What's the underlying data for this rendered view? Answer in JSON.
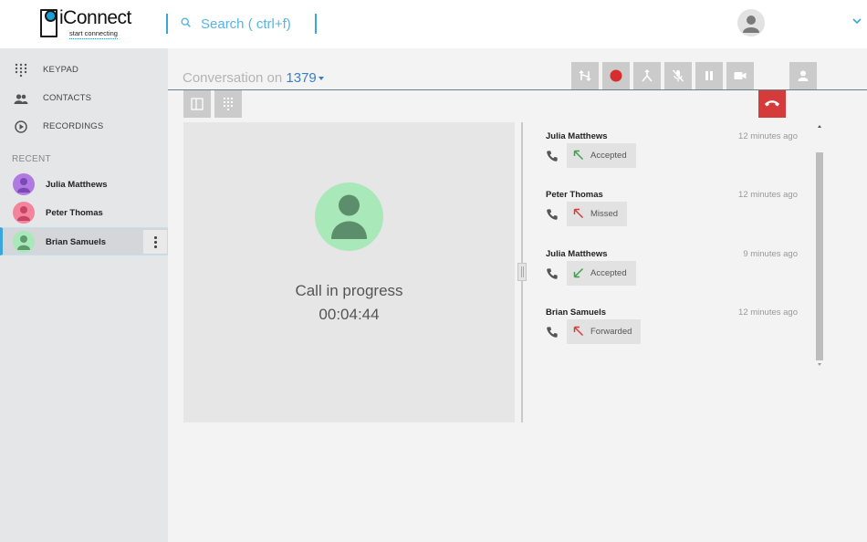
{
  "app": {
    "logo_name": "iConnect",
    "logo_tagline": "start connecting",
    "brand_color": "#1aa0d8"
  },
  "search": {
    "placeholder": "Search ( ctrl+f)",
    "icon": "search-icon"
  },
  "header": {
    "user_avatar_icon": "user-avatar-icon",
    "menu_icon": "chevron-down-icon"
  },
  "sidebar": {
    "nav": [
      {
        "label": "KEYPAD",
        "icon": "keypad-icon"
      },
      {
        "label": "CONTACTS",
        "icon": "contacts-icon"
      },
      {
        "label": "RECORDINGS",
        "icon": "play-circle-icon"
      }
    ],
    "recent_header": "RECENT",
    "recent": [
      {
        "name": "Julia Matthews",
        "avatar_color": "#b07be0",
        "figure_color": "#7b48b5"
      },
      {
        "name": "Peter Thomas",
        "avatar_color": "#f2849c",
        "figure_color": "#c84466"
      },
      {
        "name": "Brian Samuels",
        "avatar_color": "#a8e8b9",
        "figure_color": "#5d9a6f",
        "active": true
      }
    ]
  },
  "conversation": {
    "title_prefix": "Conversation on",
    "number": "1379",
    "toolbar": [
      {
        "icon": "transfer-icon"
      },
      {
        "icon": "record-icon"
      },
      {
        "icon": "merge-icon"
      },
      {
        "icon": "mute-mic-icon"
      },
      {
        "icon": "pause-icon"
      },
      {
        "icon": "video-icon"
      },
      {
        "icon": "contact-icon"
      }
    ],
    "secondary_toolbar": [
      {
        "icon": "split-panel-icon"
      },
      {
        "icon": "dialpad-icon"
      }
    ],
    "hangup_icon": "hangup-icon",
    "hangup_color": "#d63b3b"
  },
  "call": {
    "status": "Call in progress",
    "timer": "00:04:44",
    "avatar_color": "#a8e8b9"
  },
  "history": [
    {
      "name": "Julia Matthews",
      "time": "12 minutes ago",
      "status": "Accepted",
      "arrow_color": "#3aa04a"
    },
    {
      "name": "Peter Thomas",
      "time": "12 minutes ago",
      "status": "Missed",
      "arrow_color": "#d63b3b"
    },
    {
      "name": "Julia Matthews",
      "time": "9 minutes ago",
      "status": "Accepted",
      "arrow_color": "#3aa04a"
    },
    {
      "name": "Brian Samuels",
      "time": "12 minutes ago",
      "status": "Forwarded",
      "arrow_color": "#d63b3b"
    }
  ]
}
